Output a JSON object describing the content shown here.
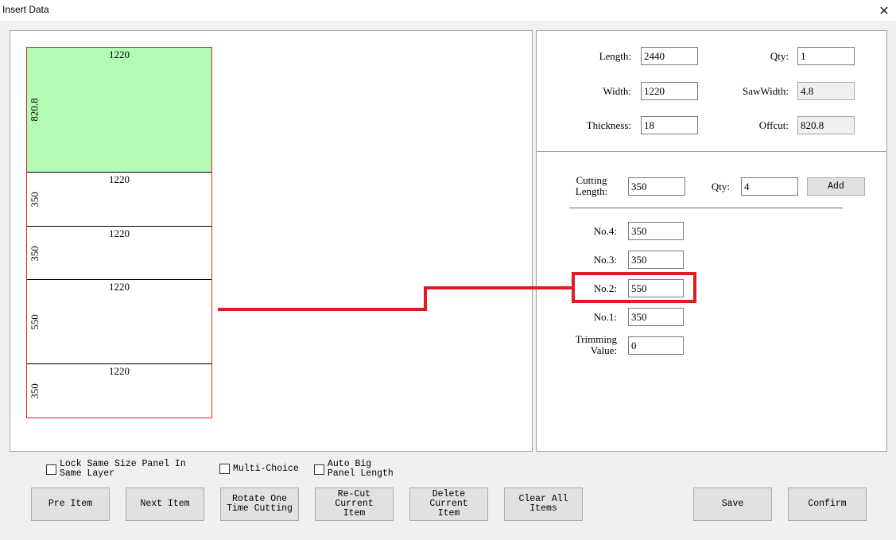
{
  "window": {
    "title": "Insert Data",
    "close_glyph": "✕"
  },
  "layout": {
    "pieces": [
      {
        "width": "1220",
        "length": "820.8",
        "offcut": true
      },
      {
        "width": "1220",
        "length": "350",
        "offcut": false
      },
      {
        "width": "1220",
        "length": "350",
        "offcut": false
      },
      {
        "width": "1220",
        "length": "550",
        "offcut": false
      },
      {
        "width": "1220",
        "length": "350",
        "offcut": false
      }
    ]
  },
  "sheet": {
    "length_label": "Length:",
    "length": "2440",
    "qty_label": "Qty:",
    "qty": "1",
    "width_label": "Width:",
    "width": "1220",
    "sawwidth_label": "SawWidth:",
    "sawwidth": "4.8",
    "thickness_label": "Thickness:",
    "thickness": "18",
    "offcut_label": "Offcut:",
    "offcut": "820.8"
  },
  "cutting": {
    "length_label_1": "Cutting",
    "length_label_2": "Length:",
    "length": "350",
    "qty_label": "Qty:",
    "qty": "4",
    "add_label": "Add",
    "no4_label": "No.4:",
    "no4": "350",
    "no3_label": "No.3:",
    "no3": "350",
    "no2_label": "No.2:",
    "no2": "550",
    "no1_label": "No.1:",
    "no1": "350",
    "trim_label_1": "Trimming",
    "trim_label_2": "Value:",
    "trim": "0"
  },
  "options": {
    "lock_label_1": "Lock Same Size Panel In",
    "lock_label_2": "Same Layer",
    "multi_label": "Multi-Choice",
    "auto_label_1": "Auto Big",
    "auto_label_2": "Panel Length"
  },
  "buttons": {
    "pre_item": "Pre Item",
    "next_item": "Next Item",
    "rotate_1": "Rotate One",
    "rotate_2": "Time Cutting",
    "recut_1": "Re-Cut Current",
    "recut_2": "Item",
    "delete_1": "Delete Current",
    "delete_2": "Item",
    "clear_1": "Clear All",
    "clear_2": "Items",
    "save": "Save",
    "confirm": "Confirm"
  },
  "colors": {
    "offcut_fill": "#b3fbb3",
    "board_outline": "#e02020",
    "highlight": "#e01b24"
  }
}
